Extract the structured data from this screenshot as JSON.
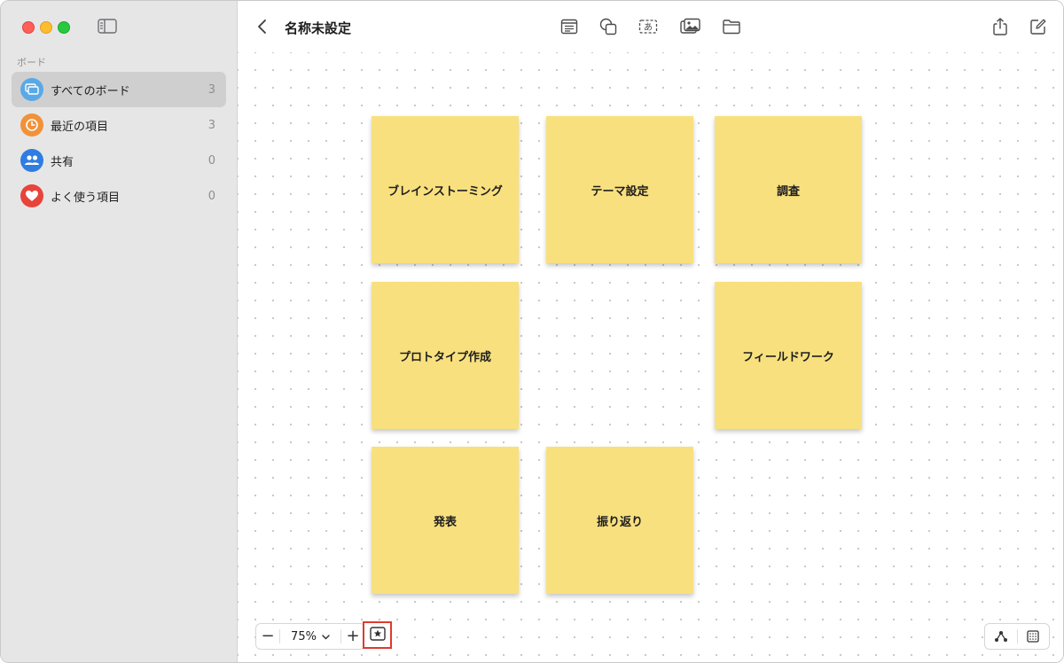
{
  "sidebar": {
    "section_label": "ボード",
    "items": [
      {
        "label": "すべてのボード",
        "count": "3",
        "icon": "boards-icon",
        "color": "#5aa9e6",
        "selected": true
      },
      {
        "label": "最近の項目",
        "count": "3",
        "icon": "clock-icon",
        "color": "#f0923a",
        "selected": false
      },
      {
        "label": "共有",
        "count": "0",
        "icon": "people-icon",
        "color": "#2f7de1",
        "selected": false
      },
      {
        "label": "よく使う項目",
        "count": "0",
        "icon": "heart-icon",
        "color": "#e8443a",
        "selected": false
      }
    ]
  },
  "toolbar": {
    "title": "名称未設定",
    "icons": [
      "text-box-icon",
      "shape-icon",
      "text-icon",
      "media-icon",
      "folder-icon",
      "share-icon",
      "compose-icon"
    ]
  },
  "canvas": {
    "notes": [
      "ブレインストーミング",
      "テーマ設定",
      "調査",
      "プロトタイプ作成",
      "フィールドワーク",
      "発表",
      "振り返り"
    ],
    "note_color": "#f8e07e"
  },
  "zoom": {
    "minus": "−",
    "value": "75%",
    "plus": "+",
    "favorite_icon": "star-box-icon",
    "highlight_color": "#e03a2f"
  },
  "bottom_right": {
    "icons": [
      "connection-icon",
      "grid-icon"
    ]
  }
}
